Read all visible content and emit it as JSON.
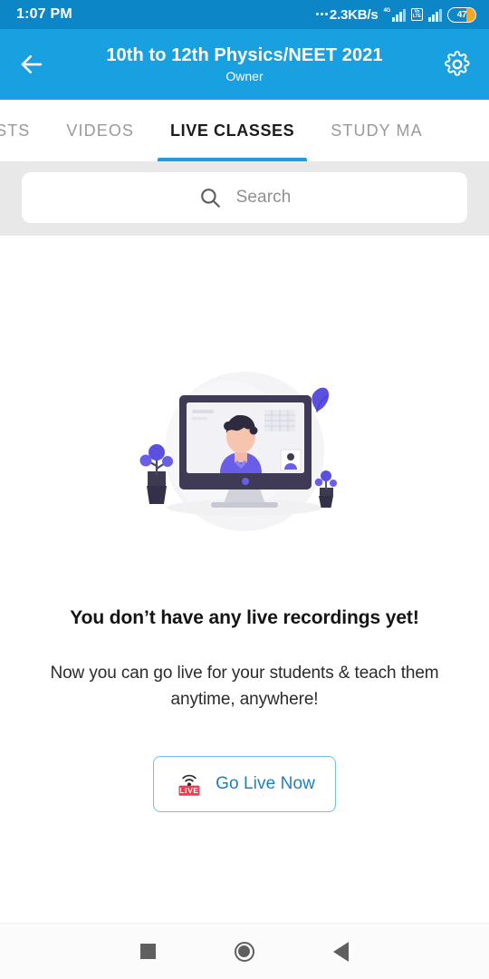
{
  "status_bar": {
    "time": "1:07 PM",
    "network_speed": "2.3KB/s",
    "network_type": "4G",
    "volte_line1": "Vo",
    "volte_line2": "LTE",
    "battery_level": "47"
  },
  "app_bar": {
    "back_icon": "back-arrow-icon",
    "title": "10th to 12th Physics/NEET 2021",
    "subtitle": "Owner",
    "settings_icon": "gear-icon"
  },
  "tabs": [
    {
      "label": "ESTS",
      "active": false
    },
    {
      "label": "VIDEOS",
      "active": false
    },
    {
      "label": "LIVE CLASSES",
      "active": true
    },
    {
      "label": "STUDY MA",
      "active": false
    }
  ],
  "search": {
    "placeholder": "Search",
    "value": "",
    "icon": "search-icon"
  },
  "empty_state": {
    "illustration": "video-call-monitor-illustration",
    "title": "You don’t have any live recordings yet!",
    "description": "Now you can go live for your students & teach them anytime, anywhere!",
    "button_label": "Go Live Now",
    "button_icon": "live-broadcast-icon",
    "live_badge_text": "LIVE"
  },
  "nav_bar": {
    "recents_icon": "square-recents-icon",
    "home_icon": "circle-home-icon",
    "back_icon": "triangle-back-icon"
  },
  "colors": {
    "status_bar": "#0d86c7",
    "app_bar": "#19a0e0",
    "tab_active_underline": "#1ca0da",
    "search_section_bg": "#e8e8e8",
    "button_border": "#6cc3e8",
    "button_text": "#1d7fc0",
    "live_badge": "#ef3b4f",
    "illustration_accent": "#5b4fe0"
  }
}
